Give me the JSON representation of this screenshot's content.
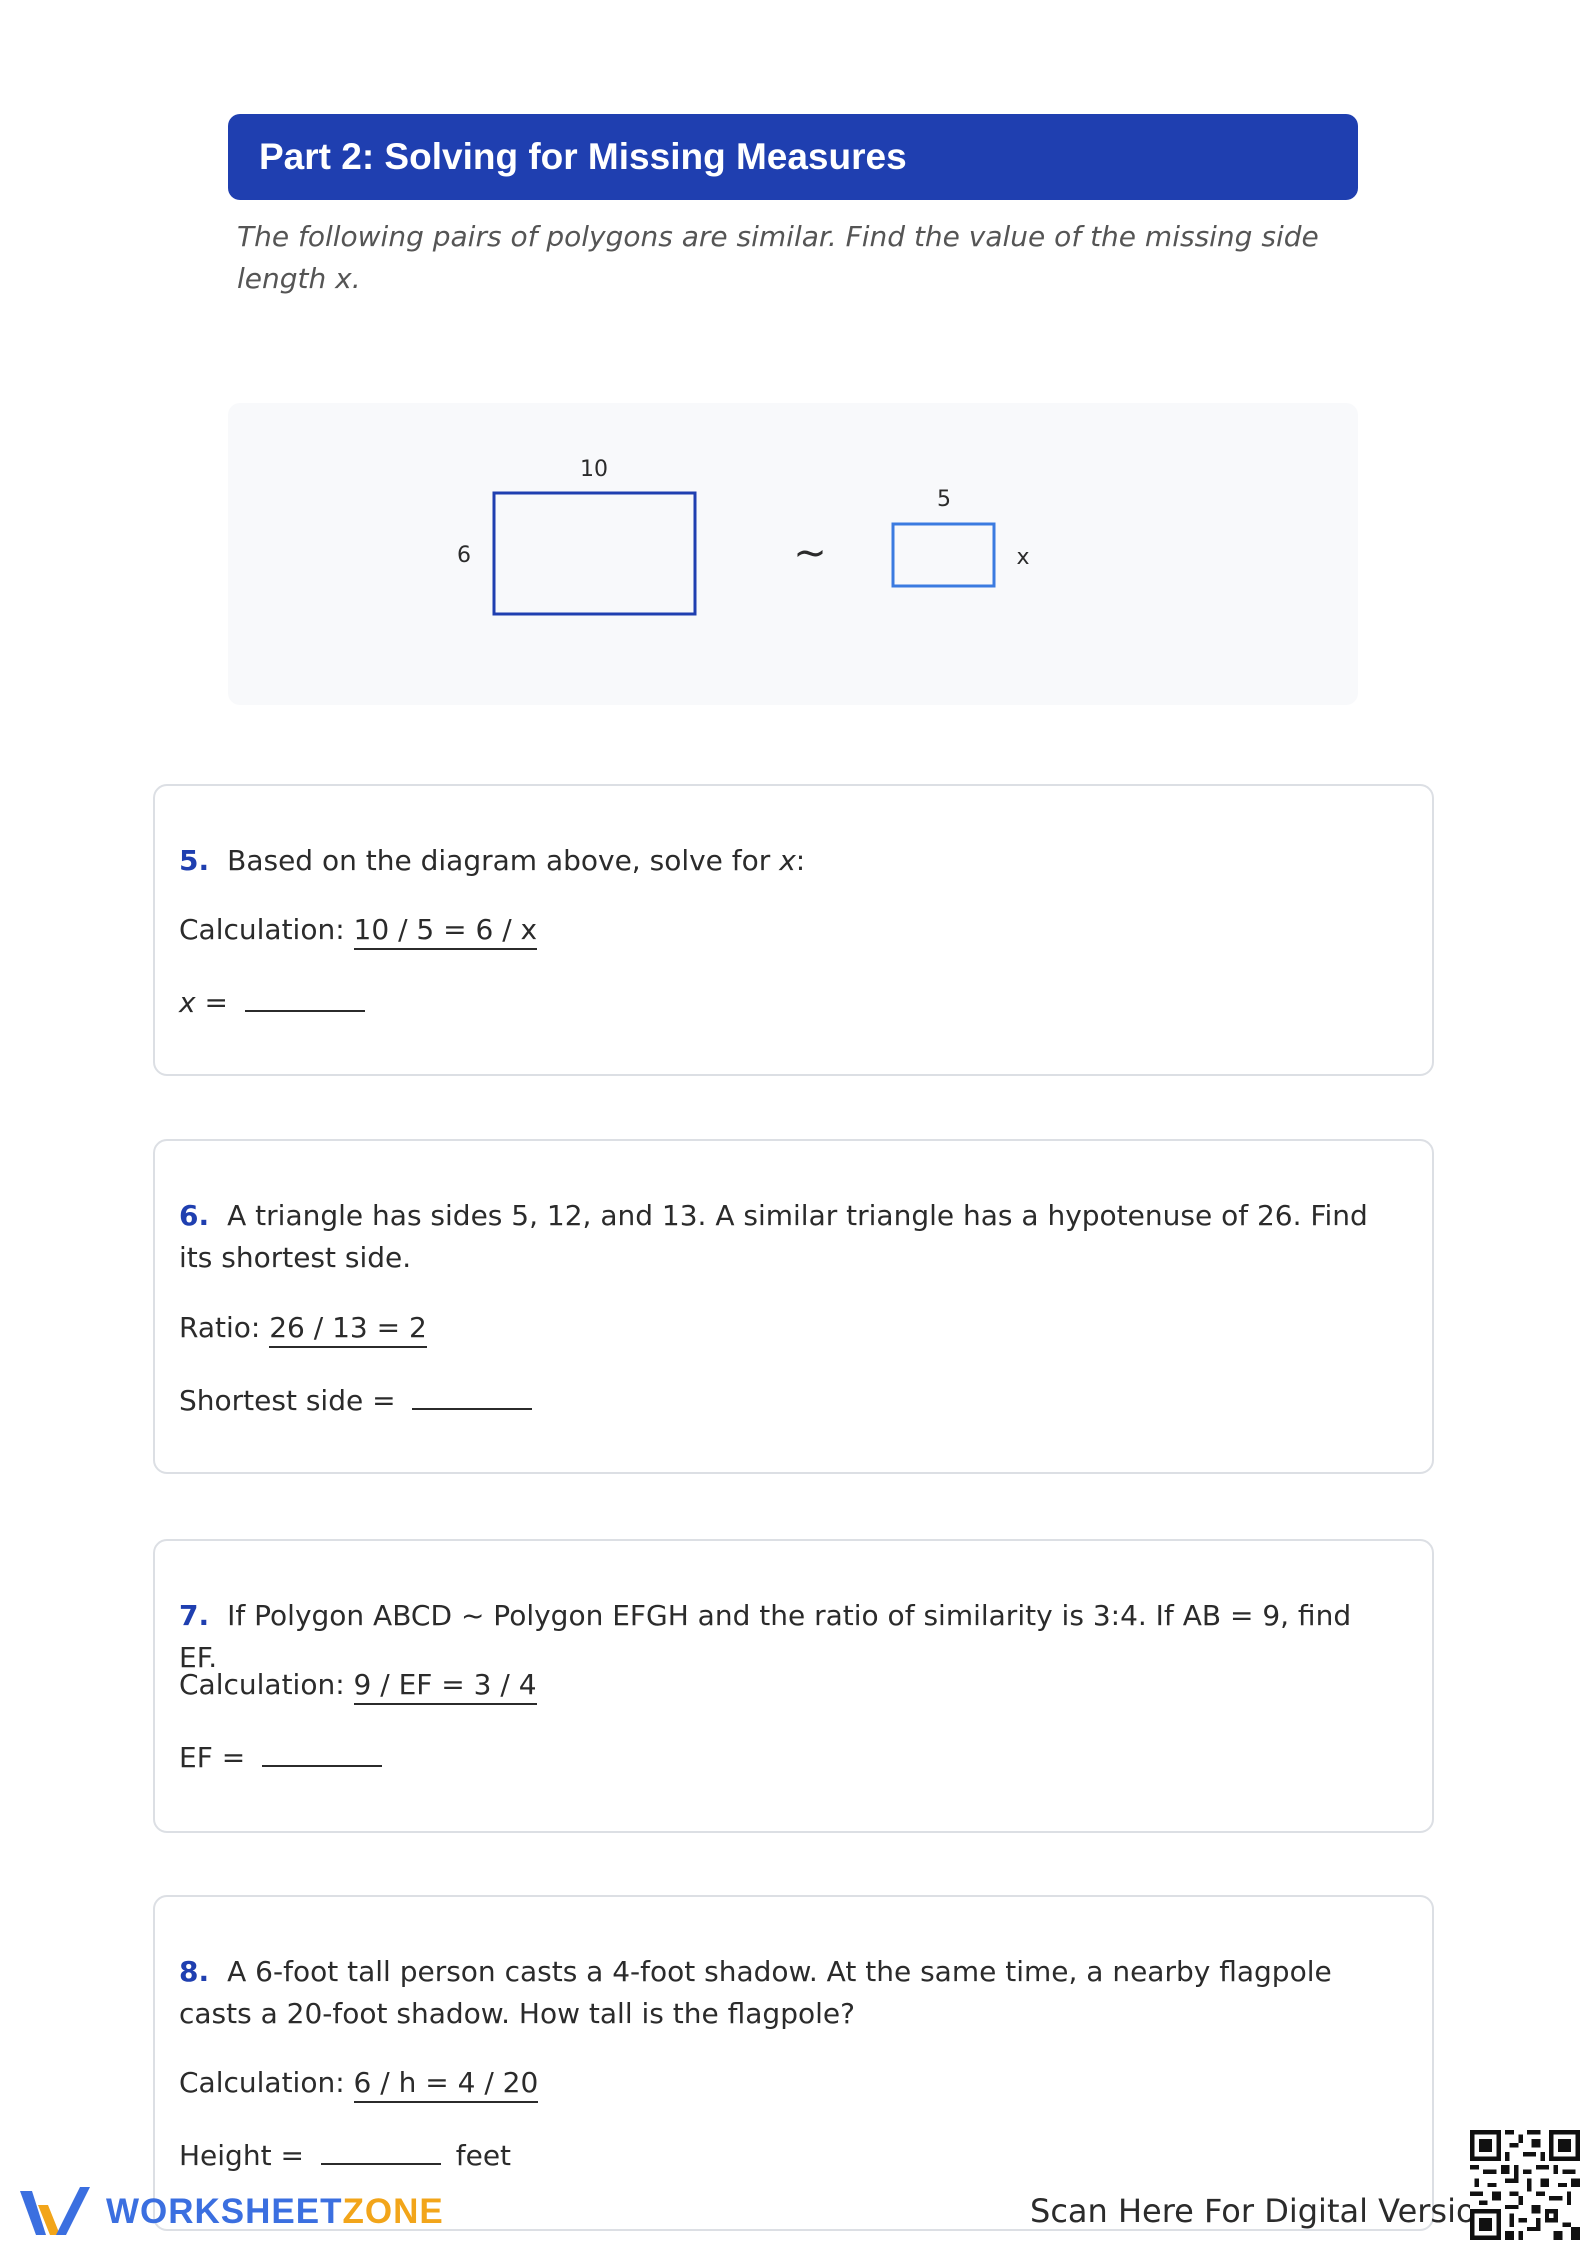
{
  "header": {
    "title": "Part 2: Solving for Missing Measures"
  },
  "instructions": {
    "text": "The following pairs of polygons are similar. Find the value of the missing side length x."
  },
  "diagram": {
    "large_rect": {
      "top_label": "10",
      "side_label": "6"
    },
    "similar_symbol": "~",
    "small_rect": {
      "top_label": "5",
      "side_label": "x"
    },
    "stroke_color": "#1f3fb0",
    "small_stroke_color": "#3b7be0"
  },
  "questions": [
    {
      "number": "5.",
      "text_before": "Based on the diagram above, solve for ",
      "text_var": "x",
      "text_after": ":",
      "calc_label": "Calculation:",
      "calc_value": "10 / 5 = 6 / x",
      "answer_label": "x =",
      "answer_value": ""
    },
    {
      "number": "6.",
      "text": "A triangle has sides 5, 12, and 13. A similar triangle has a hypotenuse of 26. Find its shortest side.",
      "calc_label": "Ratio:",
      "calc_value": "26 / 13 = 2",
      "answer_label": "Shortest side =",
      "answer_value": ""
    },
    {
      "number": "7.",
      "text": "If Polygon ABCD ~ Polygon EFGH and the ratio of similarity is 3:4. If AB = 9, find EF.",
      "calc_label": "Calculation:",
      "calc_value": "9 / EF = 3 / 4",
      "answer_label": "EF =",
      "answer_value": ""
    },
    {
      "number": "8.",
      "text": "A 6-foot tall person casts a 4-foot shadow. At the same time, a nearby flagpole casts a 20-foot shadow. How tall is the flagpole?",
      "calc_label": "Calculation:",
      "calc_value": "6 / h = 4 / 20",
      "answer_label": "Height =",
      "answer_value": "",
      "answer_unit": "feet"
    }
  ],
  "footer": {
    "brand_part1": "WORKSHEET",
    "brand_part2": "ZONE",
    "scan_text": "Scan Here For Digital Version",
    "accent_blue": "#3b6fe0",
    "accent_orange": "#f2a51a"
  }
}
